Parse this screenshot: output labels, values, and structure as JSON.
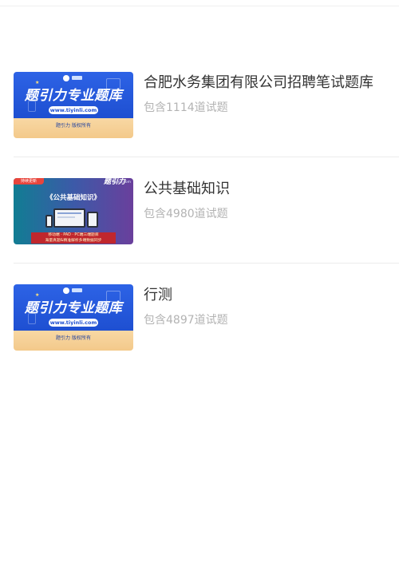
{
  "items": [
    {
      "title": "合肥水务集团有限公司招聘笔试题库",
      "count": "包含1114道试题",
      "thumb": {
        "headline": "题引力专业题库",
        "url": "www.tiyinli.com",
        "copyright": "题引力 版权所有"
      }
    },
    {
      "title": "公共基础知识",
      "count": "包含4980道试题",
      "thumb": {
        "badge": "持续更新",
        "brand": "题引力",
        "brand_url": "tiyinli.com",
        "heading": "《公共基础知识》",
        "banner_line1": "移动端 · PAD · PC端三端题库",
        "banner_line2": "海量真题&精准解析多端数据同步"
      }
    },
    {
      "title": "行测",
      "count": "包含4897道试题",
      "thumb": {
        "headline": "题引力专业题库",
        "url": "www.tiyinli.com",
        "copyright": "题引力 版权所有"
      }
    }
  ]
}
